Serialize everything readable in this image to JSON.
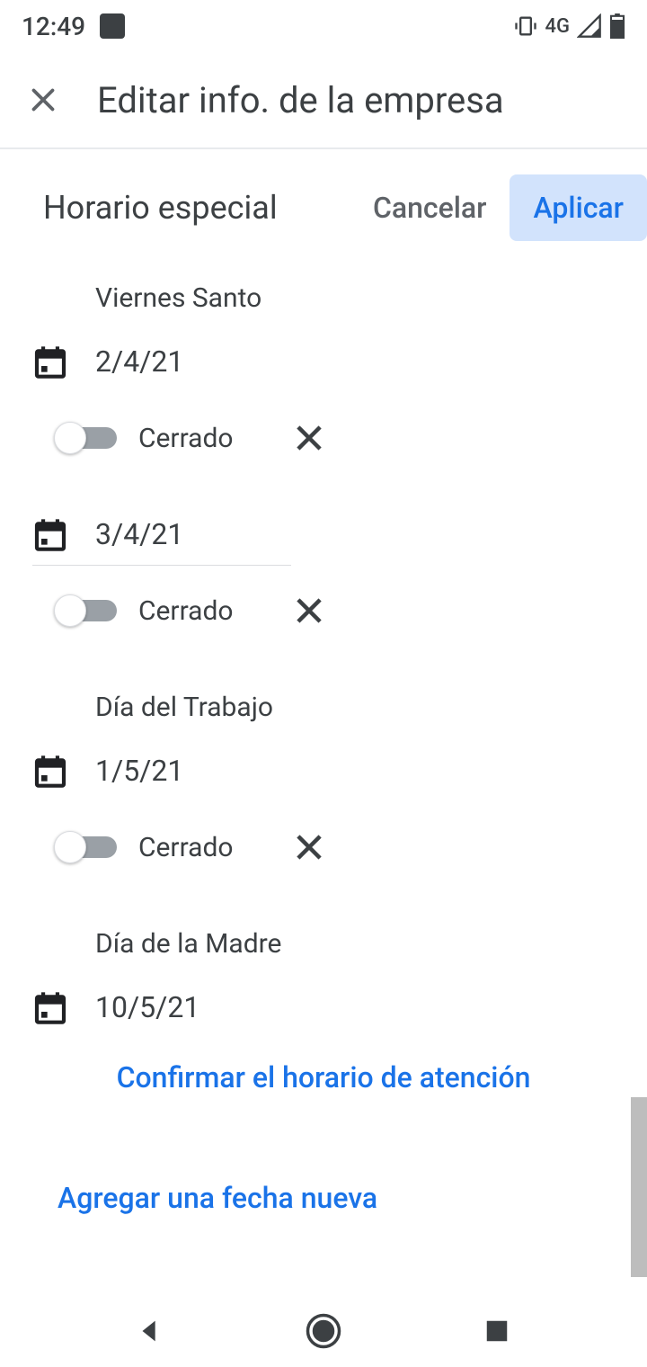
{
  "statusbar": {
    "time": "12:49",
    "network": "4G"
  },
  "appbar": {
    "title": "Editar info. de la empresa"
  },
  "subheader": {
    "title": "Horario especial",
    "cancel_label": "Cancelar",
    "apply_label": "Aplicar"
  },
  "entries": [
    {
      "holiday": "Viernes Santo",
      "date": "2/4/21",
      "status": "Cerrado"
    },
    {
      "holiday": "",
      "date": "3/4/21",
      "status": "Cerrado"
    },
    {
      "holiday": "Día del Trabajo",
      "date": "1/5/21",
      "status": "Cerrado"
    },
    {
      "holiday": "Día de la Madre",
      "date": "10/5/21"
    }
  ],
  "confirm_label": "Confirmar el horario de atención",
  "add_label": "Agregar una fecha nueva"
}
